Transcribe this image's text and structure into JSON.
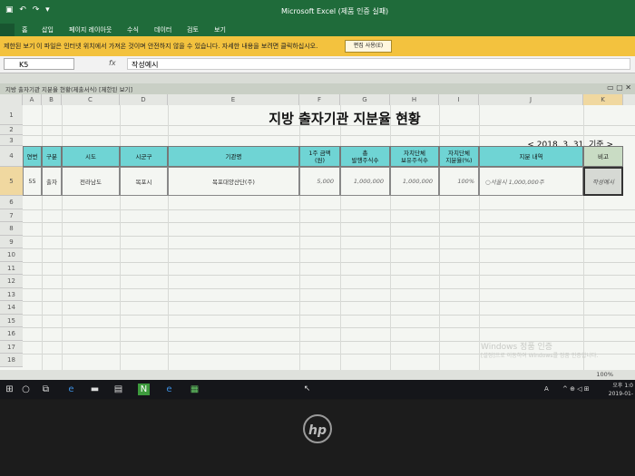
{
  "window": {
    "title": "Microsoft Excel (제품 인증 실패)"
  },
  "ribbon_tabs": [
    "홈",
    "삽입",
    "페이지 레이아웃",
    "수식",
    "데이터",
    "검토",
    "보기"
  ],
  "protected_view": {
    "label": "제한된 보기",
    "message": "이 파일은 인터넷 위치에서 가져온 것이며 안전하지 않을 수 있습니다. 자세한 내용을 보려면 클릭하십시오.",
    "button": "편집 사용(E)"
  },
  "formula_bar": {
    "name_box": "K5",
    "fx": "fx",
    "value": "작성예시"
  },
  "workbook": {
    "title": "지방 출자기관 지분율 현황(제출서식) [제한된 보기]"
  },
  "columns": [
    "A",
    "B",
    "C",
    "D",
    "E",
    "F",
    "G",
    "H",
    "I",
    "J",
    "K"
  ],
  "rows": [
    "1",
    "2",
    "3",
    "4",
    "5",
    "6",
    "7",
    "8",
    "9",
    "10",
    "11",
    "12",
    "13",
    "14",
    "15",
    "16",
    "17",
    "18"
  ],
  "sheet": {
    "title": "지방 출자기관 지분율 현황",
    "date": "< 2018. 3. 31. 기준 >",
    "headers": {
      "no": "연번",
      "type": "구분",
      "sido": "시도",
      "sigungu": "시군구",
      "org": "기관명",
      "price1": "1주 금액",
      "price2": "(원)",
      "issued1": "총",
      "issued2": "발행주식수",
      "owned1": "자치단체",
      "owned2": "보유주식수",
      "ratio1": "자치단체",
      "ratio2": "지분율(%)",
      "detail": "지분 내역",
      "note": "비고"
    },
    "row": {
      "no": "55",
      "type": "출자",
      "sido": "전라남도",
      "sigungu": "목포시",
      "org": "목포대양산단(주)",
      "price": "5,000",
      "issued": "1,000,000",
      "owned": "1,000,000",
      "ratio": "100%",
      "detail": "○서울시 1,000,000주",
      "note": "작성예시"
    }
  },
  "watermark": {
    "line1": "Windows 정품 인증",
    "line2": "[설정]으로 이동하여 Windows를 정품 인증합니다."
  },
  "status": {
    "zoom": "100%"
  },
  "taskbar": {
    "tray_lang": "A",
    "tray_symbols": "^ ⊕ ◁ ⊞",
    "time": "오후 1:0",
    "date": "2019-01-"
  },
  "device": {
    "logo": "hp"
  }
}
